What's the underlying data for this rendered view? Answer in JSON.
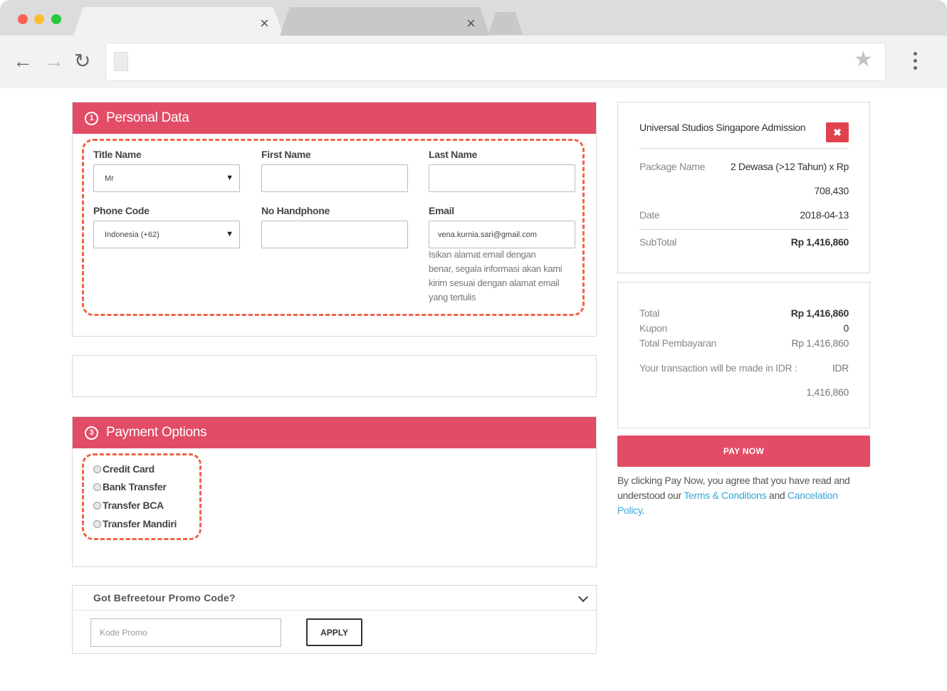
{
  "browser": {
    "tab_close": "×",
    "back_icon": "←",
    "forward_icon": "→",
    "reload_icon": "↻",
    "star_icon": "★"
  },
  "personal": {
    "step": "1",
    "title": "Personal Data",
    "title_name_label": "Title Name",
    "title_name_value": "Mr",
    "first_name_label": "First Name",
    "first_name_value": "",
    "last_name_label": "Last Name",
    "last_name_value": "",
    "phone_code_label": "Phone Code",
    "phone_code_value": "Indonesia (+62)",
    "handphone_label": "No Handphone",
    "handphone_value": "",
    "email_label": "Email",
    "email_value": "vena.kurnia.sari@gmail.com",
    "email_help": [
      "Isikan alamat email dengan",
      "benar, segala informasi akan kami",
      "kirim sesuai dengan alamat email",
      "yang tertulis"
    ],
    "caret": "▼"
  },
  "payment": {
    "step": "3",
    "title": "Payment Options",
    "options": [
      "Credit Card",
      "Bank Transfer",
      "Transfer BCA",
      "Transfer Mandiri"
    ]
  },
  "promo": {
    "title": "Got Befreetour Promo Code?",
    "placeholder": "Kode Promo",
    "apply": "APPLY"
  },
  "summary": {
    "title": "Universal Studios Singapore Admission",
    "remove": "✖",
    "package_label": "Package Name",
    "package_value_1": "2 Dewasa (>12 Tahun) x Rp",
    "package_value_2": "708,430",
    "date_label": "Date",
    "date_value": "2018-04-13",
    "subtotal_label": "SubTotal",
    "subtotal_value": "Rp 1,416,860"
  },
  "totals": {
    "total_label": "Total",
    "total_value": "Rp 1,416,860",
    "kupon_label": "Kupon",
    "kupon_value": "0",
    "pembayaran_label": "Total Pembayaran",
    "pembayaran_value": "Rp 1,416,860",
    "idr_label": "Your transaction will be made in IDR :",
    "idr_currency": "IDR",
    "idr_amount": "1,416,860"
  },
  "pay": {
    "button": "PAY NOW",
    "agree_prefix": "By clicking Pay Now, you agree that you have read and understood our ",
    "terms_link": "Terms & Conditions",
    "and": " and ",
    "cancel_link": "Cancelation Policy",
    "suffix": "."
  },
  "colors": {
    "accent": "#e24c66",
    "highlight": "#f06546",
    "link": "#3ba6d4",
    "remove": "#e0434d"
  }
}
